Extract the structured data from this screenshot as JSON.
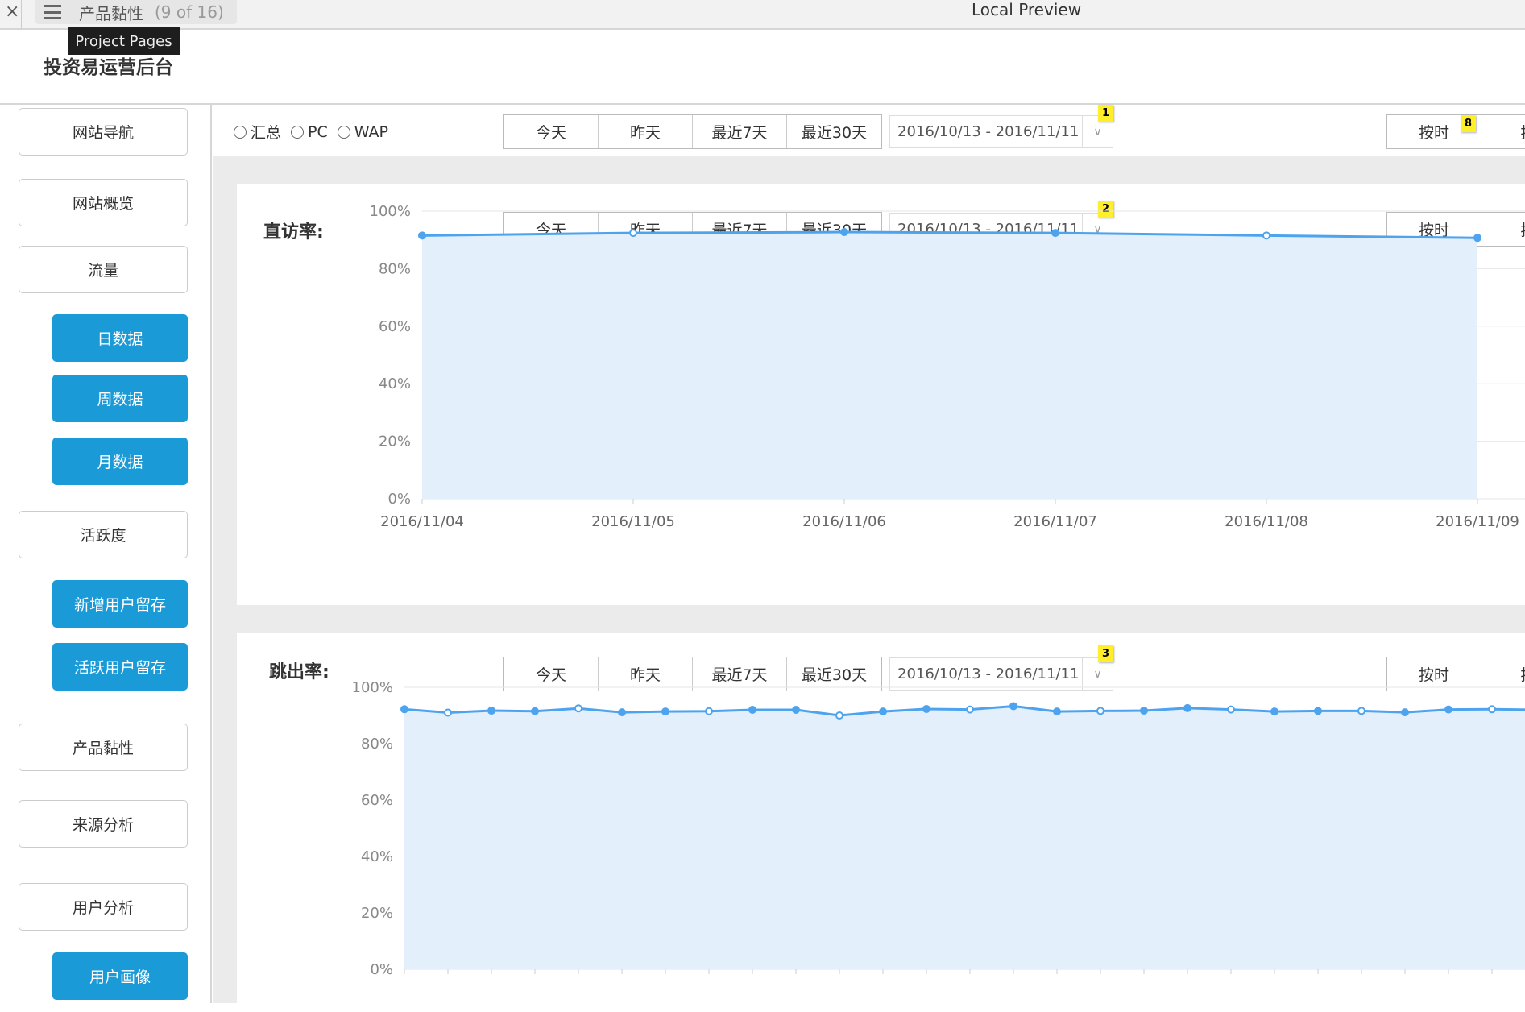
{
  "topbar": {
    "close": "×",
    "page_name": "产品黏性",
    "page_count": "(9 of 16)",
    "window_title": "Local Preview",
    "tooltip": "Project Pages"
  },
  "brand": "投资易运营后台",
  "sidebar": {
    "items": [
      {
        "label": "网站导航",
        "type": "main"
      },
      {
        "label": "网站概览",
        "type": "main"
      },
      {
        "label": "流量",
        "type": "main"
      },
      {
        "label": "日数据",
        "type": "sub"
      },
      {
        "label": "周数据",
        "type": "sub"
      },
      {
        "label": "月数据",
        "type": "sub"
      },
      {
        "label": "活跃度",
        "type": "main"
      },
      {
        "label": "新增用户留存",
        "type": "sub"
      },
      {
        "label": "活跃用户留存",
        "type": "sub"
      },
      {
        "label": "产品黏性",
        "type": "main"
      },
      {
        "label": "来源分析",
        "type": "main"
      },
      {
        "label": "用户分析",
        "type": "main"
      },
      {
        "label": "用户画像",
        "type": "sub"
      }
    ]
  },
  "filter": {
    "radios": [
      "汇总",
      "PC",
      "WAP"
    ],
    "ranges": [
      "今天",
      "昨天",
      "最近7天",
      "最近30天"
    ],
    "date_range": "2016/10/13 - 2016/11/11",
    "badge": "1",
    "hour_buttons": [
      "按时",
      "按"
    ],
    "hour_badge": "8"
  },
  "colors": {
    "accent": "#1a9ad6",
    "line": "#4ea3ef",
    "area": "#e3effb",
    "badge": "#ffef2a"
  },
  "chart_data": [
    {
      "type": "area",
      "title": "直访率:",
      "badge": "2",
      "ranges": [
        "今天",
        "昨天",
        "最近7天",
        "最近30天"
      ],
      "date_range": "2016/10/13 - 2016/11/11",
      "hour_buttons": [
        "按时",
        "按"
      ],
      "yticks": [
        "100%",
        "80%",
        "60%",
        "40%",
        "20%",
        "0%"
      ],
      "ylim": [
        0,
        100
      ],
      "categories": [
        "2016/11/04",
        "2016/11/05",
        "2016/11/06",
        "2016/11/07",
        "2016/11/08",
        "2016/11/09"
      ],
      "values": [
        91.5,
        92.4,
        92.7,
        92.4,
        91.5,
        90.7
      ]
    },
    {
      "type": "area",
      "title": "跳出率:",
      "badge": "3",
      "ranges": [
        "今天",
        "昨天",
        "最近7天",
        "最近30天"
      ],
      "date_range": "2016/10/13 - 2016/11/11",
      "hour_buttons": [
        "按时",
        "按"
      ],
      "yticks": [
        "100%",
        "80%",
        "60%",
        "40%",
        "20%",
        "0%"
      ],
      "ylim": [
        0,
        100
      ],
      "values": [
        92.2,
        91.0,
        91.7,
        91.5,
        92.5,
        91.1,
        91.4,
        91.5,
        92.0,
        92.0,
        90.0,
        91.4,
        92.3,
        92.1,
        93.3,
        91.4,
        91.6,
        91.7,
        92.6,
        92.1,
        91.4,
        91.6,
        91.6,
        91.1,
        92.1,
        92.2,
        92.0
      ]
    }
  ]
}
